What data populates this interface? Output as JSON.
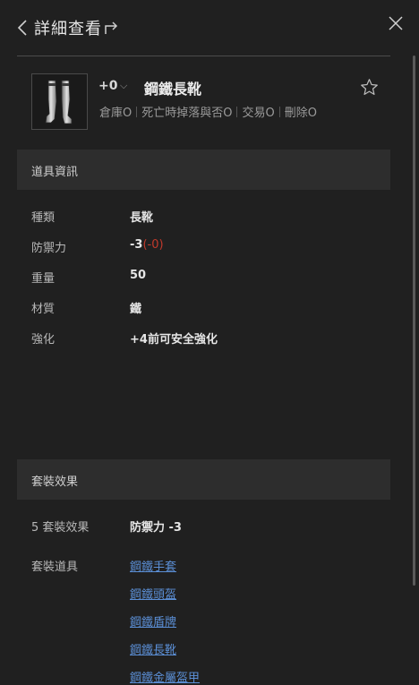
{
  "header": {
    "title": "詳細查看"
  },
  "item": {
    "enchant_label": "+0",
    "name": "鋼鐵長靴",
    "attributes": [
      "倉庫O",
      "死亡時掉落與否O",
      "交易O",
      "刪除O"
    ]
  },
  "info_section": {
    "title": "道具資訊",
    "rows": [
      {
        "label": "種類",
        "value": "長靴"
      },
      {
        "label": "防禦力",
        "value": "-3",
        "modifier": "(-0)"
      },
      {
        "label": "重量",
        "value": "50"
      },
      {
        "label": "材質",
        "value": "鐵"
      },
      {
        "label": "強化",
        "value": "+4前可安全強化"
      }
    ]
  },
  "set_section": {
    "title": "套裝效果",
    "effect_label": "5 套裝效果",
    "effect_value": "防禦力 -3",
    "items_label": "套裝道具",
    "items": [
      "鋼鐵手套",
      "鋼鐵頭盔",
      "鋼鐵盾牌",
      "鋼鐵長靴",
      "鋼鐵金屬盔甲"
    ]
  },
  "colors": {
    "background": "#202020",
    "section_bar": "#2d2d2d",
    "link": "#5b8fd6",
    "negative": "#c0392b"
  },
  "icons": {
    "back": "chevron-left-icon",
    "share": "share-icon",
    "close": "close-icon",
    "favorite": "star-icon",
    "enchant_dropdown": "chevron-down-icon"
  }
}
